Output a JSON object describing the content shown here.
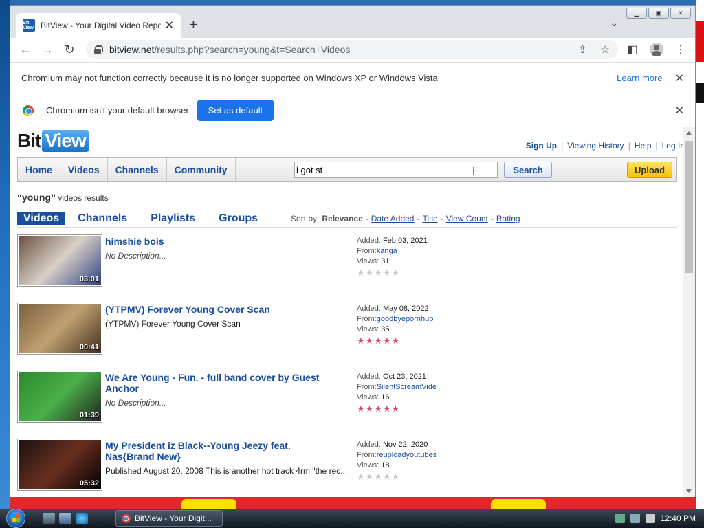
{
  "browser": {
    "tab_title": "BitView - Your Digital Video Repo",
    "tab_favicon_text": "Bit View",
    "url_host": "bitview.net",
    "url_path": "/results.php?search=young&t=Search+Videos",
    "infobar1_text": "Chromium may not function correctly because it is no longer supported on Windows XP or Windows Vista",
    "infobar1_link": "Learn more",
    "infobar2_text": "Chromium isn't your default browser",
    "infobar2_button": "Set as default"
  },
  "site": {
    "logo_bit": "Bit",
    "logo_view": "View",
    "toplinks": [
      "Sign Up",
      "Viewing History",
      "Help",
      "Log In"
    ],
    "nav": [
      "Home",
      "Videos",
      "Channels",
      "Community"
    ],
    "search_value": "i got st",
    "search_button": "Search",
    "upload_button": "Upload",
    "results_query": "“young”",
    "results_suffix": " videos results",
    "result_tabs": [
      "Videos",
      "Channels",
      "Playlists",
      "Groups"
    ],
    "sort_label": "Sort by:",
    "sort_current": "Relevance",
    "sort_options": [
      "Date Added",
      "Title",
      "View Count",
      "Rating"
    ],
    "meta_labels": {
      "added": "Added:",
      "from": "From:",
      "views": "Views:"
    }
  },
  "videos": [
    {
      "title": "himshie bois",
      "description": "No Description...",
      "desc_italic": true,
      "duration": "03:01",
      "added": "Feb 03, 2021",
      "from": "kanga",
      "views": "31",
      "rating": 0,
      "thumb_colors": [
        "#6a5040",
        "#d8d0c8",
        "#304080"
      ]
    },
    {
      "title": "(YTPMV) Forever Young Cover Scan",
      "description": "(YTPMV) Forever Young Cover Scan",
      "desc_italic": false,
      "duration": "00:41",
      "added": "May 08, 2022",
      "from": "goodbyepornhub",
      "views": "35",
      "rating": 4.5,
      "thumb_colors": [
        "#7a6040",
        "#c0a070",
        "#403020"
      ]
    },
    {
      "title": "We Are Young - Fun. - full band cover by Guest Anchor",
      "description": "No Description...",
      "desc_italic": true,
      "duration": "01:39",
      "added": "Oct 23, 2021",
      "from": "SilentScreamVideos",
      "views": "16",
      "rating": 5,
      "thumb_colors": [
        "#2a8a2a",
        "#4ab04a",
        "#222"
      ]
    },
    {
      "title": "My President iz Black--Young Jeezy feat. Nas{Brand New}",
      "description": "Published August 20, 2008 This is another hot track 4rm \"the rec...",
      "desc_italic": false,
      "duration": "05:32",
      "added": "Nov 22, 2020",
      "from": "reuploadyoutubes",
      "views": "18",
      "rating": 0,
      "thumb_colors": [
        "#1a1010",
        "#6a3020",
        "#000"
      ]
    }
  ],
  "taskbar": {
    "window_label": "BitView - Your Digit...",
    "clock": "12:40 PM"
  }
}
